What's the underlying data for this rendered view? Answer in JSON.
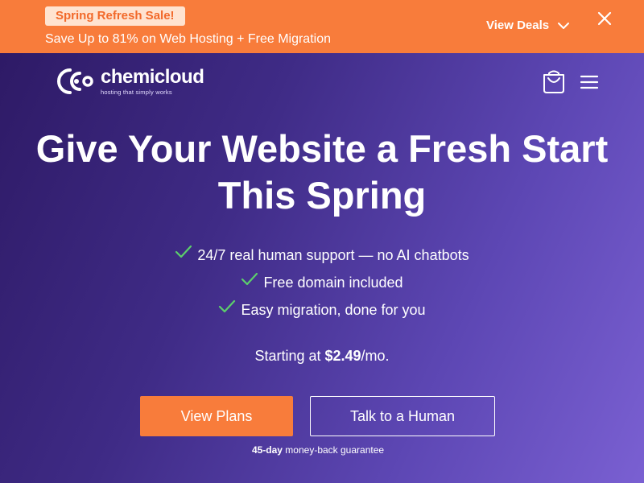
{
  "promo": {
    "badge": "Spring Refresh Sale!",
    "text": "Save Up to 81% on Web Hosting + Free Migration",
    "view_deals": "View Deals"
  },
  "header": {
    "logo_name": "chemicloud",
    "logo_tagline": "hosting that simply works"
  },
  "hero": {
    "headline_line1": "Give Your Website a Fresh Start",
    "headline_line2": "This Spring",
    "features": [
      "24/7 real human support — no AI chatbots",
      "Free domain included",
      "Easy migration, done for you"
    ],
    "price_prefix": "Starting at ",
    "price": "$2.49",
    "price_suffix": "/mo.",
    "primary_button": "View Plans",
    "secondary_button": "Talk to a Human",
    "guarantee_bold": "45-day",
    "guarantee_text": " money-back guarantee"
  },
  "colors": {
    "accent": "#f87c3b",
    "check": "#5ccf6b",
    "hero_start": "#2e1a66",
    "hero_end": "#7a60d2"
  },
  "icons": [
    "chevron-down-icon",
    "close-icon",
    "logo-icon",
    "cart-icon",
    "menu-icon",
    "check-icon"
  ]
}
